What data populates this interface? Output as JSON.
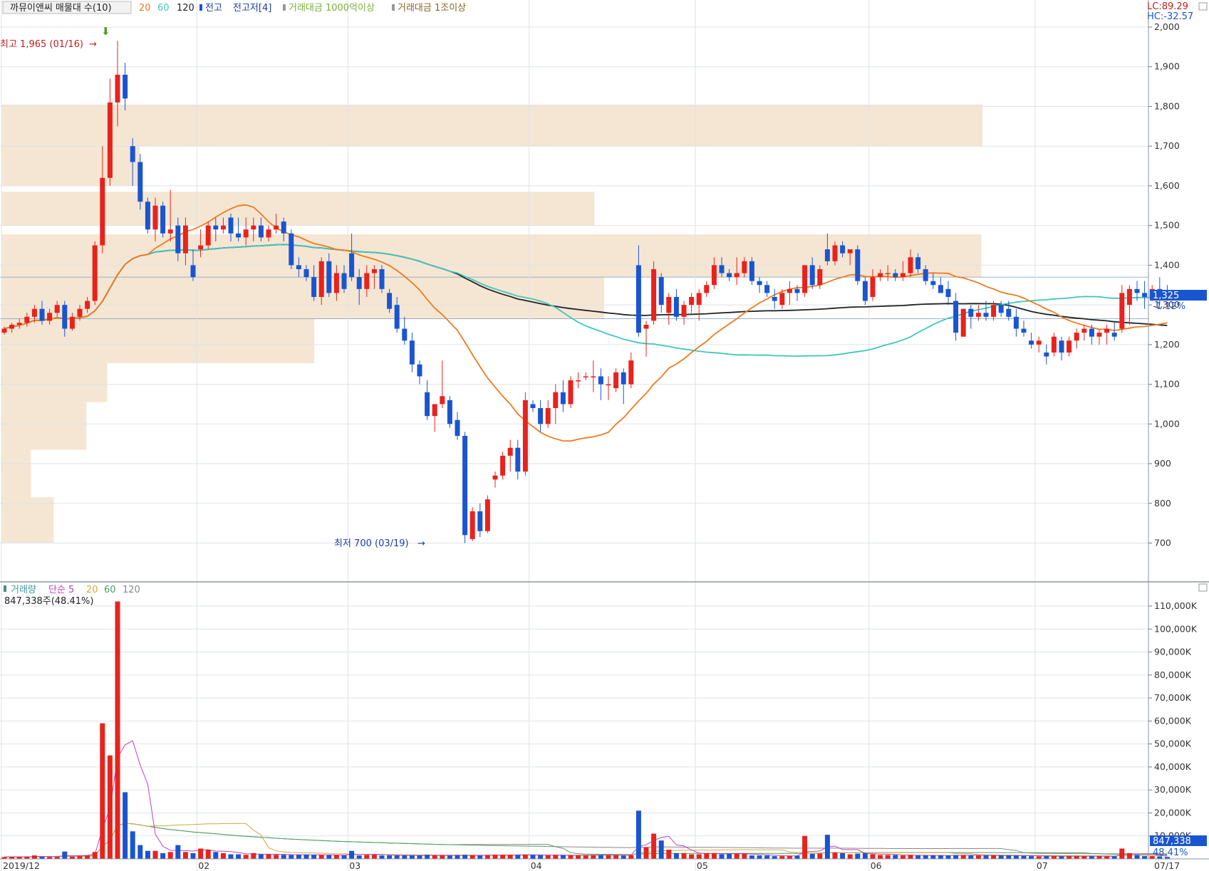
{
  "legend": {
    "title_box": "까뮤이앤씨 매물대 수(10)",
    "ma20": "20",
    "ma60": "60",
    "ma120": "120",
    "high_low_label": "전고",
    "high_low_n": "전고저[4]",
    "value_1000": "거래대금 1000억이상",
    "value_1t": "거래대금 1조이상"
  },
  "corner": {
    "lc": "LC:89.29",
    "hc": "HC:-32.57"
  },
  "annotations": {
    "high": "최고 1,965 (01/16)",
    "low": "최저 700 (03/19)"
  },
  "current": {
    "price": "1,325",
    "change": "-1.12%"
  },
  "volume_panel": {
    "label": "거래량",
    "ma_label": "단순 5",
    "ma20": "20",
    "ma60": "60",
    "ma120": "120",
    "info": "847,338주(48.41%)",
    "current_volume": "847,338",
    "current_pct": "48.41%"
  },
  "colors": {
    "up": "#e8221c",
    "down": "#1a55d0",
    "ma20": "#f07a1e",
    "ma60": "#3cc7c0",
    "ma120": "#222222",
    "vol_ma5": "#c040c0",
    "vol_ma20": "#d4a640",
    "vol_ma60": "#4aa060",
    "vol_ma120": "#888888",
    "profile": "#f5e6d3",
    "grid": "#dde3ea"
  },
  "chart_data": {
    "type": "candlestick",
    "price_axis": {
      "ticks": [
        "2,000",
        "1,900",
        "1,800",
        "1,700",
        "1,600",
        "1,500",
        "1,400",
        "1,300",
        "1,200",
        "1,100",
        "1,000",
        "900",
        "800",
        "700"
      ],
      "range": [
        590,
        2020
      ]
    },
    "volume_axis": {
      "ticks": [
        "110,000K",
        "100,000K",
        "90,000K",
        "80,000K",
        "70,000K",
        "60,000K",
        "50,000K",
        "40,000K",
        "30,000K",
        "20,000K",
        "10,000K"
      ],
      "range": [
        0,
        116000
      ]
    },
    "x_labels": [
      "2019/12",
      "02",
      "03",
      "04",
      "05",
      "06",
      "07",
      "07/17"
    ],
    "month_starts": [
      0,
      26,
      46,
      70,
      92,
      115,
      137
    ],
    "volume_profile": [
      {
        "low": 1700,
        "high": 1805,
        "extent": 0.9
      },
      {
        "low": 1600,
        "high": 1700,
        "extent": 0.127
      },
      {
        "low": 1500,
        "high": 1585,
        "extent": 0.544
      },
      {
        "low": 1370,
        "high": 1478,
        "extent": 0.899
      },
      {
        "low": 1265,
        "high": 1370,
        "extent": 0.553
      },
      {
        "low": 1153,
        "high": 1265,
        "extent": 0.287
      },
      {
        "low": 1055,
        "high": 1153,
        "extent": 0.097
      },
      {
        "low": 935,
        "high": 1055,
        "extent": 0.078
      },
      {
        "low": 815,
        "high": 935,
        "extent": 0.027
      },
      {
        "low": 700,
        "high": 815,
        "extent": 0.048
      }
    ],
    "candles": [
      [
        1230,
        1245,
        1225,
        1240
      ],
      [
        1240,
        1255,
        1230,
        1250
      ],
      [
        1250,
        1265,
        1240,
        1255
      ],
      [
        1255,
        1280,
        1245,
        1270
      ],
      [
        1270,
        1300,
        1255,
        1290
      ],
      [
        1290,
        1310,
        1250,
        1260
      ],
      [
        1260,
        1290,
        1250,
        1280
      ],
      [
        1280,
        1310,
        1270,
        1300
      ],
      [
        1300,
        1310,
        1220,
        1240
      ],
      [
        1240,
        1280,
        1235,
        1270
      ],
      [
        1270,
        1300,
        1260,
        1290
      ],
      [
        1290,
        1320,
        1280,
        1310
      ],
      [
        1310,
        1460,
        1300,
        1450
      ],
      [
        1450,
        1700,
        1430,
        1620
      ],
      [
        1620,
        1870,
        1600,
        1810
      ],
      [
        1810,
        1965,
        1750,
        1880
      ],
      [
        1880,
        1910,
        1790,
        1820
      ],
      [
        1700,
        1720,
        1600,
        1660
      ],
      [
        1660,
        1680,
        1540,
        1560
      ],
      [
        1560,
        1570,
        1480,
        1490
      ],
      [
        1490,
        1570,
        1460,
        1550
      ],
      [
        1550,
        1560,
        1470,
        1480
      ],
      [
        1480,
        1590,
        1460,
        1490
      ],
      [
        1500,
        1520,
        1410,
        1430
      ],
      [
        1430,
        1520,
        1400,
        1500
      ],
      [
        1400,
        1440,
        1360,
        1370
      ],
      [
        1440,
        1490,
        1420,
        1450
      ],
      [
        1450,
        1510,
        1440,
        1500
      ],
      [
        1500,
        1520,
        1460,
        1490
      ],
      [
        1490,
        1520,
        1480,
        1500
      ],
      [
        1520,
        1530,
        1460,
        1480
      ],
      [
        1480,
        1520,
        1460,
        1470
      ],
      [
        1470,
        1520,
        1450,
        1490
      ],
      [
        1490,
        1520,
        1460,
        1500
      ],
      [
        1500,
        1520,
        1460,
        1470
      ],
      [
        1470,
        1500,
        1460,
        1490
      ],
      [
        1490,
        1530,
        1480,
        1500
      ],
      [
        1510,
        1520,
        1460,
        1480
      ],
      [
        1480,
        1490,
        1390,
        1400
      ],
      [
        1400,
        1420,
        1370,
        1390
      ],
      [
        1390,
        1400,
        1360,
        1370
      ],
      [
        1370,
        1400,
        1310,
        1320
      ],
      [
        1320,
        1420,
        1300,
        1410
      ],
      [
        1410,
        1430,
        1320,
        1330
      ],
      [
        1330,
        1400,
        1310,
        1380
      ],
      [
        1380,
        1400,
        1330,
        1340
      ],
      [
        1430,
        1480,
        1360,
        1370
      ],
      [
        1370,
        1390,
        1300,
        1340
      ],
      [
        1340,
        1400,
        1320,
        1380
      ],
      [
        1380,
        1400,
        1340,
        1390
      ],
      [
        1390,
        1400,
        1330,
        1340
      ],
      [
        1330,
        1340,
        1280,
        1290
      ],
      [
        1300,
        1320,
        1230,
        1240
      ],
      [
        1240,
        1270,
        1200,
        1210
      ],
      [
        1210,
        1230,
        1130,
        1150
      ],
      [
        1150,
        1160,
        1100,
        1120
      ],
      [
        1080,
        1110,
        1010,
        1020
      ],
      [
        1020,
        1040,
        980,
        1050
      ],
      [
        1050,
        1160,
        1040,
        1070
      ],
      [
        1060,
        1070,
        990,
        1000
      ],
      [
        1010,
        1030,
        960,
        970
      ],
      [
        970,
        980,
        700,
        720
      ],
      [
        710,
        790,
        705,
        780
      ],
      [
        780,
        800,
        715,
        730
      ],
      [
        730,
        820,
        725,
        810
      ],
      [
        860,
        880,
        840,
        870
      ],
      [
        870,
        930,
        860,
        920
      ],
      [
        920,
        960,
        880,
        940
      ],
      [
        940,
        960,
        860,
        880
      ],
      [
        880,
        1080,
        870,
        1060
      ],
      [
        1050,
        1060,
        1030,
        1040
      ],
      [
        1040,
        1060,
        980,
        1000
      ],
      [
        1000,
        1060,
        990,
        1040
      ],
      [
        1040,
        1100,
        1000,
        1080
      ],
      [
        1080,
        1110,
        1030,
        1050
      ],
      [
        1050,
        1120,
        1040,
        1110
      ],
      [
        1110,
        1130,
        1090,
        1110
      ],
      [
        1120,
        1130,
        1110,
        1120
      ],
      [
        1120,
        1160,
        1080,
        1120
      ],
      [
        1120,
        1140,
        1060,
        1100
      ],
      [
        1100,
        1120,
        1060,
        1100
      ],
      [
        1090,
        1140,
        1080,
        1130
      ],
      [
        1130,
        1140,
        1050,
        1100
      ],
      [
        1100,
        1180,
        1090,
        1160
      ],
      [
        1400,
        1450,
        1220,
        1230
      ],
      [
        1240,
        1260,
        1170,
        1250
      ],
      [
        1260,
        1410,
        1250,
        1390
      ],
      [
        1370,
        1380,
        1280,
        1300
      ],
      [
        1280,
        1330,
        1250,
        1320
      ],
      [
        1320,
        1340,
        1260,
        1270
      ],
      [
        1270,
        1310,
        1250,
        1300
      ],
      [
        1300,
        1330,
        1280,
        1320
      ],
      [
        1300,
        1340,
        1260,
        1330
      ],
      [
        1330,
        1360,
        1320,
        1350
      ],
      [
        1350,
        1420,
        1340,
        1400
      ],
      [
        1400,
        1420,
        1370,
        1380
      ],
      [
        1380,
        1390,
        1360,
        1370
      ],
      [
        1370,
        1420,
        1350,
        1380
      ],
      [
        1380,
        1420,
        1370,
        1410
      ],
      [
        1410,
        1420,
        1350,
        1360
      ],
      [
        1360,
        1370,
        1330,
        1350
      ],
      [
        1350,
        1360,
        1320,
        1330
      ],
      [
        1320,
        1340,
        1290,
        1310
      ],
      [
        1300,
        1340,
        1290,
        1330
      ],
      [
        1330,
        1360,
        1300,
        1340
      ],
      [
        1340,
        1350,
        1310,
        1330
      ],
      [
        1330,
        1400,
        1320,
        1400
      ],
      [
        1400,
        1420,
        1340,
        1350
      ],
      [
        1350,
        1400,
        1340,
        1390
      ],
      [
        1440,
        1480,
        1400,
        1410
      ],
      [
        1410,
        1460,
        1400,
        1450
      ],
      [
        1450,
        1460,
        1420,
        1430
      ],
      [
        1430,
        1440,
        1400,
        1440
      ],
      [
        1440,
        1450,
        1350,
        1360
      ],
      [
        1360,
        1370,
        1300,
        1310
      ],
      [
        1320,
        1390,
        1310,
        1370
      ],
      [
        1370,
        1390,
        1360,
        1380
      ],
      [
        1380,
        1400,
        1360,
        1380
      ],
      [
        1380,
        1390,
        1360,
        1370
      ],
      [
        1370,
        1410,
        1360,
        1380
      ],
      [
        1380,
        1440,
        1370,
        1420
      ],
      [
        1420,
        1430,
        1380,
        1390
      ],
      [
        1390,
        1400,
        1350,
        1360
      ],
      [
        1360,
        1380,
        1340,
        1350
      ],
      [
        1350,
        1370,
        1340,
        1330
      ],
      [
        1340,
        1360,
        1300,
        1320
      ],
      [
        1310,
        1330,
        1210,
        1230
      ],
      [
        1220,
        1290,
        1220,
        1290
      ],
      [
        1290,
        1300,
        1240,
        1270
      ],
      [
        1270,
        1300,
        1260,
        1280
      ],
      [
        1280,
        1310,
        1260,
        1270
      ],
      [
        1270,
        1310,
        1260,
        1300
      ],
      [
        1300,
        1310,
        1270,
        1280
      ],
      [
        1290,
        1310,
        1260,
        1270
      ],
      [
        1270,
        1290,
        1220,
        1240
      ],
      [
        1240,
        1260,
        1220,
        1230
      ],
      [
        1210,
        1230,
        1190,
        1200
      ],
      [
        1200,
        1220,
        1180,
        1210
      ],
      [
        1180,
        1200,
        1150,
        1170
      ],
      [
        1180,
        1230,
        1170,
        1220
      ],
      [
        1210,
        1220,
        1160,
        1180
      ],
      [
        1180,
        1220,
        1170,
        1210
      ],
      [
        1210,
        1240,
        1190,
        1230
      ],
      [
        1230,
        1250,
        1210,
        1240
      ],
      [
        1240,
        1250,
        1200,
        1220
      ],
      [
        1220,
        1240,
        1200,
        1230
      ],
      [
        1230,
        1250,
        1200,
        1240
      ],
      [
        1230,
        1260,
        1210,
        1220
      ],
      [
        1240,
        1350,
        1230,
        1330
      ],
      [
        1300,
        1350,
        1250,
        1340
      ],
      [
        1340,
        1360,
        1310,
        1330
      ],
      [
        1330,
        1360,
        1290,
        1320
      ],
      [
        1320,
        1350,
        1310,
        1340
      ],
      [
        1340,
        1370,
        1300,
        1320
      ],
      [
        1330,
        1350,
        1310,
        1320
      ]
    ],
    "volumes_k": [
      800,
      900,
      900,
      1000,
      1500,
      900,
      800,
      900,
      3200,
      1000,
      1200,
      1500,
      3000,
      59000,
      45000,
      112000,
      29000,
      12000,
      6000,
      3500,
      3500,
      2500,
      3000,
      6000,
      3000,
      2500,
      4500,
      4000,
      3000,
      2500,
      2000,
      2000,
      1800,
      2500,
      2000,
      2000,
      1800,
      1800,
      1700,
      1800,
      1900,
      1700,
      1700,
      1600,
      1600,
      1500,
      3500,
      1500,
      1700,
      1800,
      1500,
      1500,
      1500,
      1500,
      1500,
      1500,
      1800,
      1500,
      1400,
      1400,
      1600,
      1800,
      1500,
      1400,
      1600,
      1800,
      1800,
      1800,
      1700,
      1900,
      1700,
      1600,
      1500,
      1700,
      1600,
      1500,
      1500,
      1500,
      1700,
      1700,
      1600,
      1600,
      1400,
      1600,
      21000,
      5000,
      11000,
      8000,
      4000,
      2500,
      2500,
      2000,
      2000,
      2500,
      2500,
      2000,
      2200,
      2300,
      2200,
      1500,
      1500,
      1500,
      1200,
      1200,
      1300,
      1400,
      10000,
      2200,
      2300,
      10500,
      2800,
      2500,
      2000,
      2300,
      2500,
      2000,
      1700,
      1700,
      1700,
      1500,
      1700,
      1500,
      1500,
      1500,
      1500,
      1500,
      1700,
      1700,
      1500,
      1500,
      1500,
      1500,
      1500,
      1500,
      1400,
      1300,
      1200,
      1100,
      1200,
      1200,
      1100,
      1100,
      1200,
      1200,
      1100,
      1100,
      1100,
      1100,
      4500,
      2500,
      1700,
      1200,
      1200,
      1100,
      847
    ]
  }
}
